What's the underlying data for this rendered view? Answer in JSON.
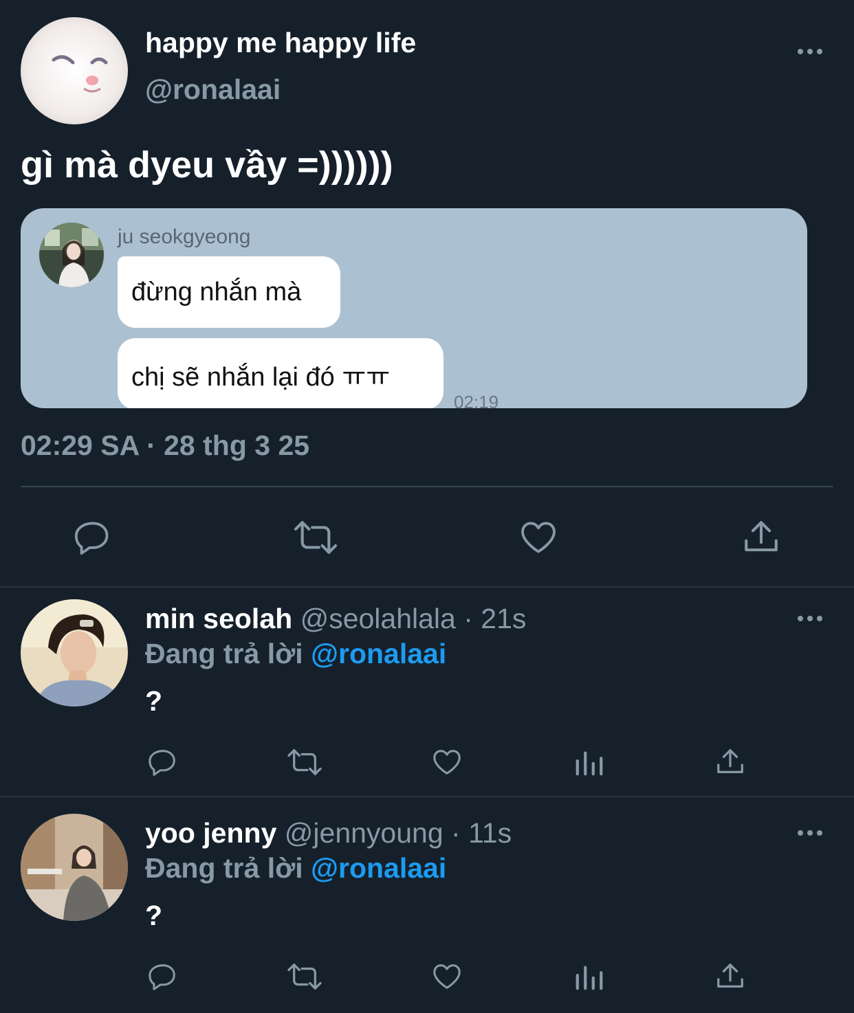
{
  "main_tweet": {
    "display_name": "happy me happy life",
    "handle": "@ronalaai",
    "text": "gì mà dyeu vầy =))))))",
    "quoted_chat": {
      "sender_name": "ju seokgyeong",
      "messages": [
        "đừng nhắn mà",
        "chị sẽ nhắn lại đó ㅠㅠ"
      ],
      "time": "02:19"
    },
    "timestamp": "02:29 SA · 28 thg 3 25",
    "actions": {
      "reply_icon": "reply-icon",
      "retweet_icon": "retweet-icon",
      "like_icon": "heart-icon",
      "share_icon": "share-icon"
    }
  },
  "replies": [
    {
      "display_name": "min seolah",
      "handle": "@seolahlala",
      "time": "· 21s",
      "replying_prefix": "Đang trả lời",
      "replying_to": "@ronalaai",
      "text": "?"
    },
    {
      "display_name": "yoo jenny",
      "handle": "@jennyoung",
      "time": "· 11s",
      "replying_prefix": "Đang trả lời",
      "replying_to": "@ronalaai",
      "text": "?"
    }
  ],
  "colors": {
    "background": "#15202b",
    "muted": "#8899a6",
    "link": "#1d9bf0",
    "quote_bg": "#abc1d1"
  }
}
